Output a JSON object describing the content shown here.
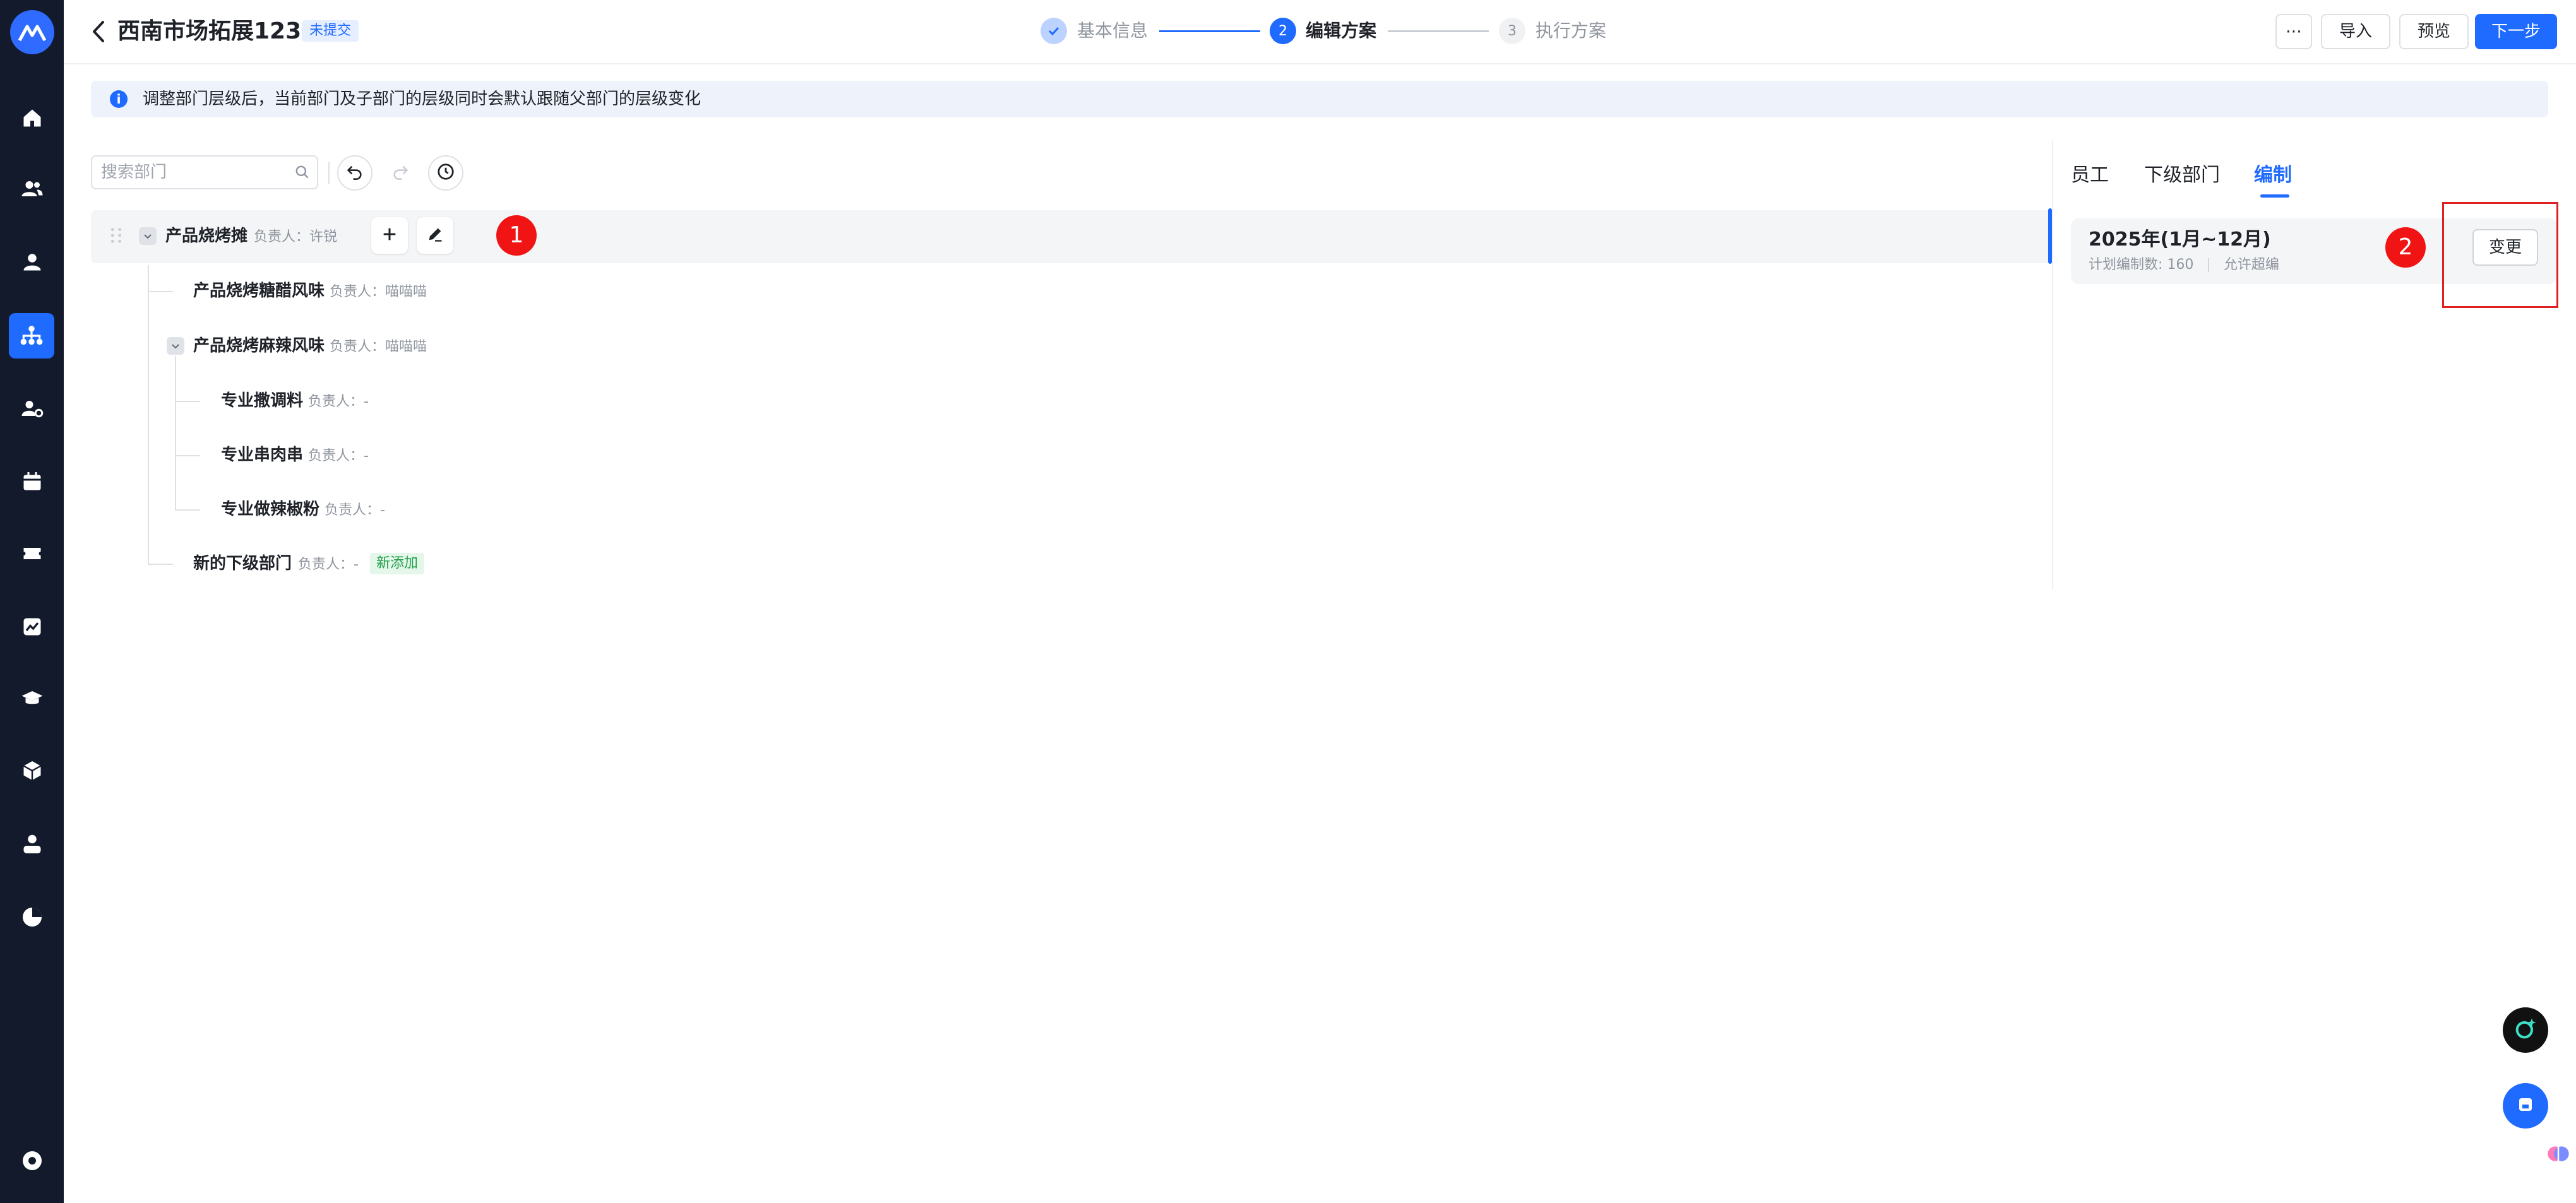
{
  "header": {
    "title": "西南市场拓展123",
    "status_badge": "未提交",
    "steps": [
      {
        "number": "✓",
        "label": "基本信息",
        "state": "done"
      },
      {
        "number": "2",
        "label": "编辑方案",
        "state": "current"
      },
      {
        "number": "3",
        "label": "执行方案",
        "state": "pending"
      }
    ],
    "more_label": "⋯",
    "import_label": "导入",
    "preview_label": "预览",
    "next_label": "下一步"
  },
  "info": {
    "text": "调整部门层级后，当前部门及子部门的层级同时会默认跟随父部门的层级变化"
  },
  "toolbar": {
    "search_placeholder": "搜索部门"
  },
  "tree": {
    "owner_prefix": "负责人：",
    "nodes": [
      {
        "name": "产品烧烤摊",
        "owner": "许锐"
      },
      {
        "name": "产品烧烤糖醋风味",
        "owner": "喵喵喵"
      },
      {
        "name": "产品烧烤麻辣风味",
        "owner": "喵喵喵"
      },
      {
        "name": "专业撒调料",
        "owner": "-"
      },
      {
        "name": "专业串肉串",
        "owner": "-"
      },
      {
        "name": "专业做辣椒粉",
        "owner": "-"
      },
      {
        "name": "新的下级部门",
        "owner": "-",
        "tag": "新添加"
      }
    ]
  },
  "annotations": [
    "1",
    "2"
  ],
  "panel": {
    "tabs": [
      "员工",
      "下级部门",
      "编制"
    ],
    "active_tab": "编制",
    "plan_title": "2025年(1月~12月)",
    "plan_count": "计划编制数: 160",
    "plan_separator": "|",
    "plan_allow": "允许超编",
    "change_label": "变更"
  },
  "colors": {
    "accent": "#1f6bff",
    "sidebar": "#121a2c",
    "annotation_red": "#f01414",
    "new_tag": "#22a04b"
  }
}
